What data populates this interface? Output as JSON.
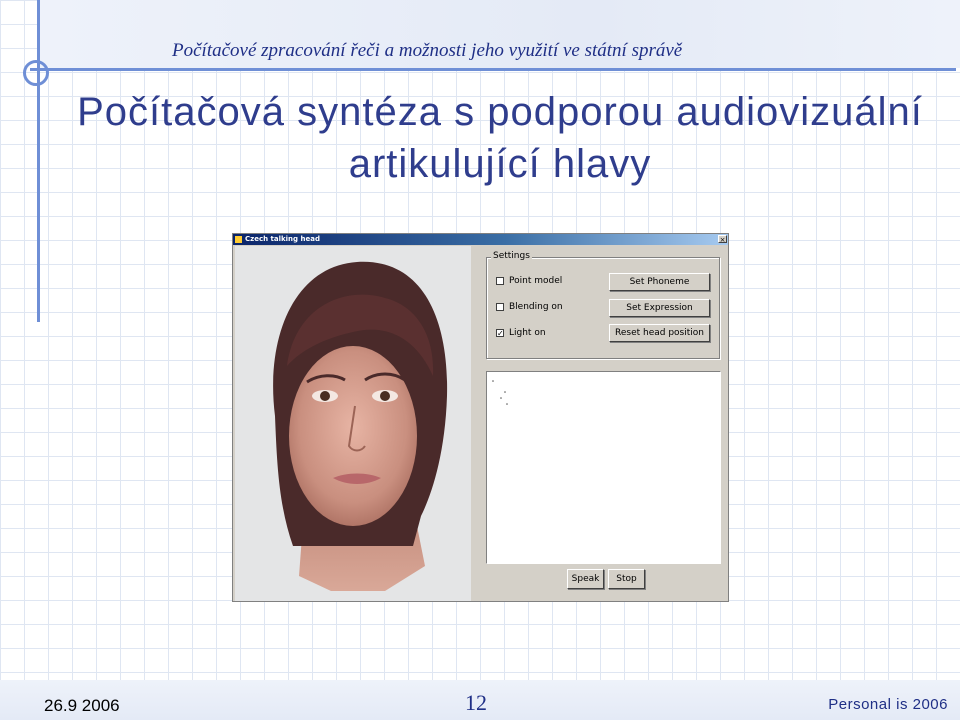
{
  "slide": {
    "header_subtitle": "Počítačové zpracování řeči a možnosti jeho využití ve státní správě",
    "title_line1": "Počítačová syntéza s podporou audiovizuální",
    "title_line2": "artikulující hlavy"
  },
  "app": {
    "window_title": "Czech talking head",
    "close_glyph": "×",
    "settings_label": "Settings",
    "checkboxes": [
      {
        "label": "Point model",
        "checked": false,
        "mark": ""
      },
      {
        "label": "Blending on",
        "checked": false,
        "mark": ""
      },
      {
        "label": "Light on",
        "checked": true,
        "mark": "✓"
      }
    ],
    "buttons": {
      "set_phoneme": "Set Phoneme",
      "set_expression": "Set Expression",
      "reset_head_position": "Reset head position",
      "speak": "Speak",
      "stop": "Stop"
    }
  },
  "footer": {
    "date": "26.9 2006",
    "page_number": "12",
    "event": "Personal is 2006"
  },
  "colors": {
    "title": "#2f3d8d",
    "accent_rule": "#6f8fd6",
    "titlebar_start": "#0a246a",
    "window_face": "#d4d0c8"
  }
}
